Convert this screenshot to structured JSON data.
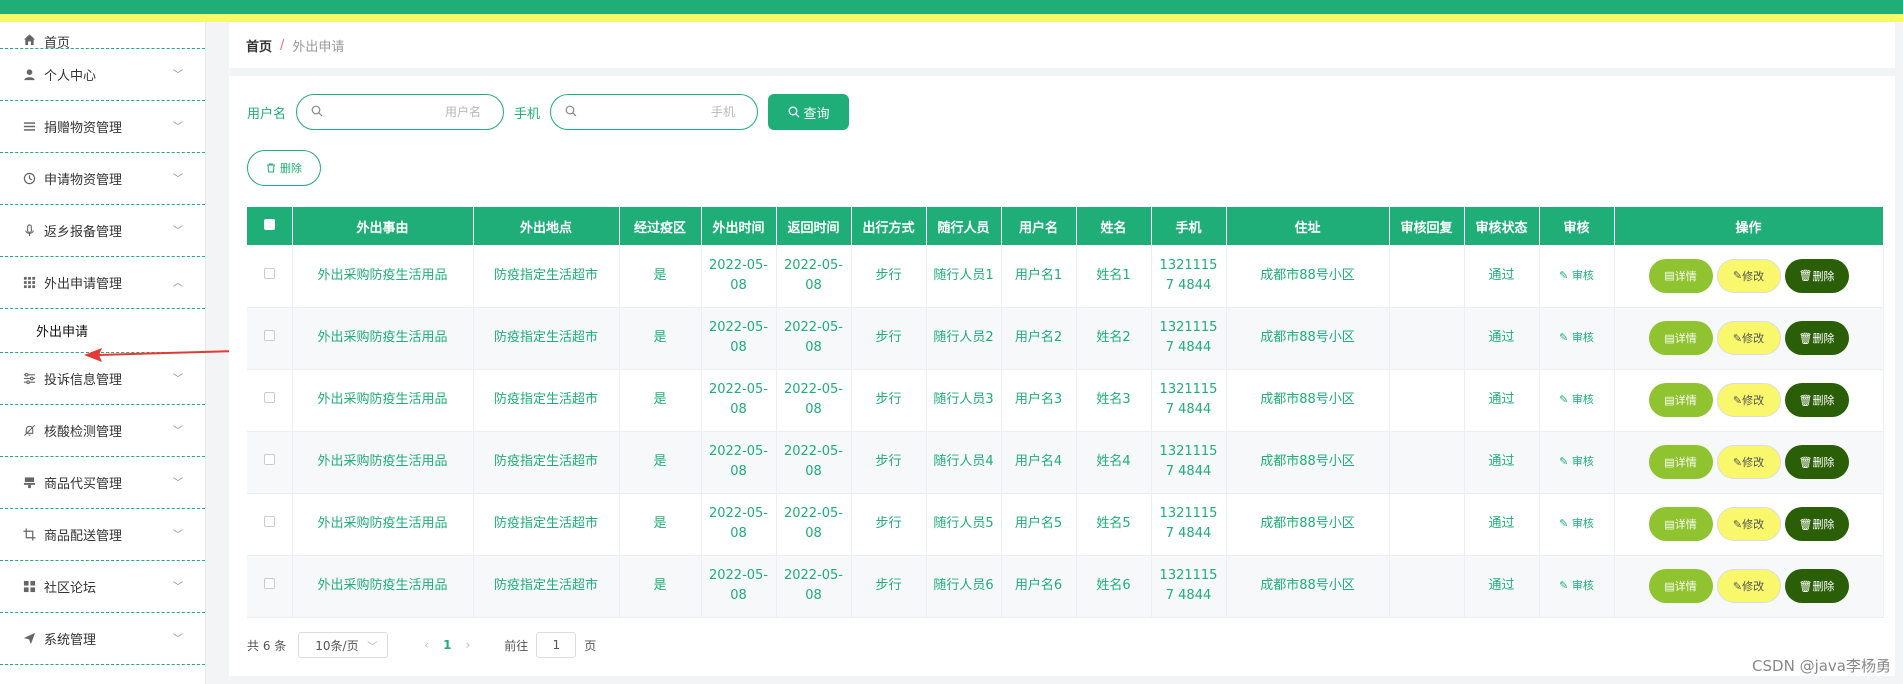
{
  "sidebar": {
    "items": [
      {
        "label": "首页",
        "icon": "home-icon"
      },
      {
        "label": "个人中心",
        "icon": "user-icon"
      },
      {
        "label": "捐赠物资管理",
        "icon": "list-icon"
      },
      {
        "label": "申请物资管理",
        "icon": "clock-icon"
      },
      {
        "label": "返乡报备管理",
        "icon": "mic-icon"
      },
      {
        "label": "外出申请管理",
        "icon": "grid-icon"
      },
      {
        "label": "投诉信息管理",
        "icon": "sliders-icon"
      },
      {
        "label": "核酸检测管理",
        "icon": "bell-off-icon"
      },
      {
        "label": "商品代买管理",
        "icon": "stamp-icon"
      },
      {
        "label": "商品配送管理",
        "icon": "crop-icon"
      },
      {
        "label": "社区论坛",
        "icon": "apps-icon"
      },
      {
        "label": "系统管理",
        "icon": "send-icon"
      }
    ],
    "sub_item": "外出申请"
  },
  "breadcrumb": {
    "home": "首页",
    "separator": "/",
    "current": "外出申请"
  },
  "search": {
    "username_label": "用户名",
    "username_placeholder": "用户名",
    "phone_label": "手机",
    "phone_placeholder": "手机",
    "query_button": "查询"
  },
  "delete_button": "删除",
  "table": {
    "headers": [
      "外出事由",
      "外出地点",
      "经过疫区",
      "外出时间",
      "返回时间",
      "出行方式",
      "随行人员",
      "用户名",
      "姓名",
      "手机",
      "住址",
      "审核回复",
      "审核状态",
      "审核",
      "操作"
    ],
    "rows": [
      {
        "reason": "外出采购防疫生活用品",
        "place": "防疫指定生活超市",
        "zone": "是",
        "out": "2022-05-08",
        "back": "2022-05-08",
        "mode": "步行",
        "companion": "随行人员1",
        "username": "用户名1",
        "name": "姓名1",
        "phone": "13211157 4844",
        "address": "成都市88号小区",
        "reply": "",
        "status": "通过",
        "audit": "审核"
      },
      {
        "reason": "外出采购防疫生活用品",
        "place": "防疫指定生活超市",
        "zone": "是",
        "out": "2022-05-08",
        "back": "2022-05-08",
        "mode": "步行",
        "companion": "随行人员2",
        "username": "用户名2",
        "name": "姓名2",
        "phone": "13211157 4844",
        "address": "成都市88号小区",
        "reply": "",
        "status": "通过",
        "audit": "审核"
      },
      {
        "reason": "外出采购防疫生活用品",
        "place": "防疫指定生活超市",
        "zone": "是",
        "out": "2022-05-08",
        "back": "2022-05-08",
        "mode": "步行",
        "companion": "随行人员3",
        "username": "用户名3",
        "name": "姓名3",
        "phone": "13211157 4844",
        "address": "成都市88号小区",
        "reply": "",
        "status": "通过",
        "audit": "审核"
      },
      {
        "reason": "外出采购防疫生活用品",
        "place": "防疫指定生活超市",
        "zone": "是",
        "out": "2022-05-08",
        "back": "2022-05-08",
        "mode": "步行",
        "companion": "随行人员4",
        "username": "用户名4",
        "name": "姓名4",
        "phone": "13211157 4844",
        "address": "成都市88号小区",
        "reply": "",
        "status": "通过",
        "audit": "审核"
      },
      {
        "reason": "外出采购防疫生活用品",
        "place": "防疫指定生活超市",
        "zone": "是",
        "out": "2022-05-08",
        "back": "2022-05-08",
        "mode": "步行",
        "companion": "随行人员5",
        "username": "用户名5",
        "name": "姓名5",
        "phone": "13211157 4844",
        "address": "成都市88号小区",
        "reply": "",
        "status": "通过",
        "audit": "审核"
      },
      {
        "reason": "外出采购防疫生活用品",
        "place": "防疫指定生活超市",
        "zone": "是",
        "out": "2022-05-08",
        "back": "2022-05-08",
        "mode": "步行",
        "companion": "随行人员6",
        "username": "用户名6",
        "name": "姓名6",
        "phone": "13211157 4844",
        "address": "成都市88号小区",
        "reply": "",
        "status": "通过",
        "audit": "审核"
      }
    ],
    "actions": {
      "detail": "详情",
      "edit": "修改",
      "delete": "删除"
    }
  },
  "pagination": {
    "total": "共 6 条",
    "page_size": "10条/页",
    "current_page": "1",
    "goto_label": "前往",
    "goto_value": "1",
    "page_suffix": "页"
  },
  "watermark": "CSDN @java李杨勇",
  "colors": {
    "primary": "#1fae78",
    "detail": "#8fc32f",
    "edit": "#f9f76b",
    "delete": "#2a5f07"
  }
}
